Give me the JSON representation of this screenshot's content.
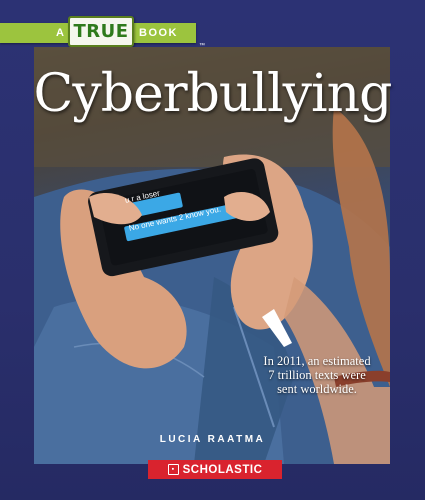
{
  "series": {
    "prefix": "A",
    "name": "TRUE",
    "suffix": "BOOK",
    "trademark": "™"
  },
  "title": "Cyberbullying",
  "phone": {
    "message_1": "u r a loser",
    "message_2": "No one wants 2 know you."
  },
  "fact": {
    "line_1": "In 2011, an estimated",
    "line_2": "7 trillion texts were",
    "line_3": "sent worldwide."
  },
  "author": "LUCIA RAATMA",
  "publisher": {
    "name": "SCHOLASTIC",
    "icon": "scholastic-logo-icon"
  },
  "colors": {
    "background": "#2a2f6e",
    "series_green": "#9cc43e",
    "publisher_red": "#d9232e",
    "message_bubble": "#3ba8e6"
  }
}
